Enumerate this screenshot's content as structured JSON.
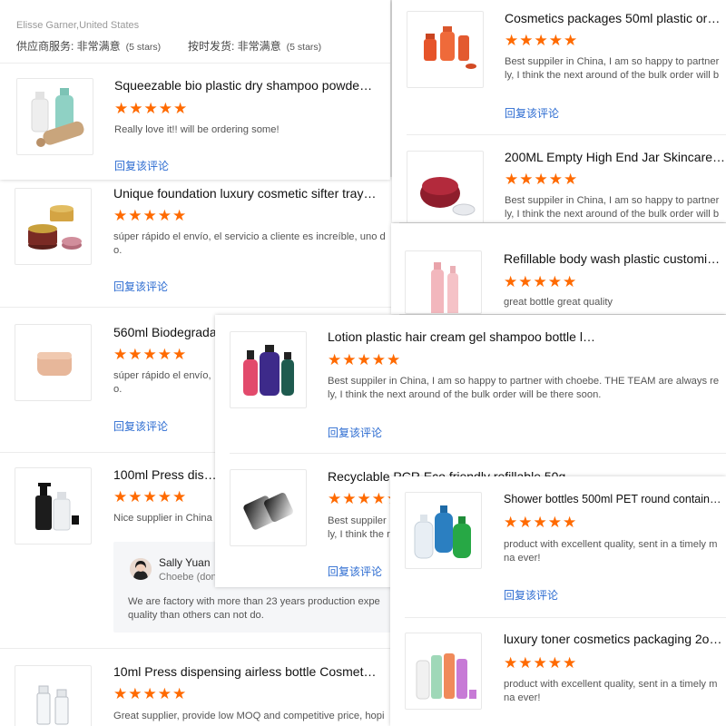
{
  "colors": {
    "star": "#ff6a00",
    "link": "#2b6bd1",
    "text": "#222222",
    "muted": "#555555"
  },
  "star_count": 5,
  "top_panel": {
    "reviewer": "Elisse Garner,United States",
    "supplier_service_label": "供应商服务: 非常满意",
    "supplier_service_stars": "(5 stars)",
    "shipping_label": "按时发货: 非常满意",
    "shipping_stars": "(5 stars)",
    "item": {
      "title": "Squeezable bio plastic dry shampoo powder b...",
      "review": "Really love it!! will be ordering some!",
      "reply": "回复该评论",
      "image_icon": "bottles-image"
    }
  },
  "left_items": [
    {
      "title": "Unique foundation luxury cosmetic sifter tray p...",
      "review_line1": "súper rápido el envío, el servicio a cliente es increíble, uno d",
      "review_line2": "o.",
      "reply": "回复该评论",
      "image_icon": "jar-image"
    },
    {
      "title": "560ml Biodegradal",
      "review_line1": "súper rápido el envío,",
      "review_line2": "o.",
      "reply": "回复该评论",
      "image_icon": "cream-jar-image"
    },
    {
      "title": "100ml Press dispe",
      "review_line1": "Nice supplier in China",
      "review_line2": "",
      "reply": "",
      "image_icon": "pump-bottle-image"
    },
    {
      "title": "10ml Press dispensing airless bottle Cosmetic...",
      "review_line1": "Great supplier, provide low MOQ and competitive price, hopi",
      "review_line2": "",
      "reply": "",
      "image_icon": "airless-bottle-image"
    }
  ],
  "seller_reply": {
    "name": "Sally Yuan",
    "company": "Choebe (dong",
    "text_line1": "We are factory with more than 23 years production expe",
    "text_line2": "quality than others can not do."
  },
  "middle_items": [
    {
      "title": "Lotion plastic hair cream gel shampoo bottle lo...",
      "review_line1": "Best suppiler in China, I am so happy to partner with choebe. THE TEAM are always re",
      "review_line2": "ly, I think the next around of the bulk order will be there soon.",
      "reply": "回复该评论",
      "image_icon": "shampoo-bottles-image"
    },
    {
      "title": "Recyclable PCR Eco friendly refillable 50g whol",
      "review_line1": "Best suppiler",
      "review_line2": "ly, I think the r",
      "reply": "回复该评论",
      "image_icon": "gradient-jar-image"
    }
  ],
  "right_items": [
    {
      "title": "Cosmetics packages 50ml plastic orange",
      "review_line1": "Best suppiler in China, I am so happy to partner",
      "review_line2": "ly, I think the next around of the bulk order will b",
      "reply": "回复该评论",
      "image_icon": "orange-bottles-image"
    },
    {
      "title": "200ML Empty High End Jar Skincare Pack",
      "review_line1": "Best suppiler in China, I am so happy to partner",
      "review_line2": "ly, I think the next around of the bulk order will b",
      "reply": "",
      "image_icon": "red-jar-image"
    },
    {
      "title": "Refillable body wash plastic customised e",
      "review_line1": "great bottle great quality",
      "review_line2": "",
      "reply": "",
      "image_icon": "pink-bottles-image"
    },
    {
      "title": "Shower bottles 500ml PET round container blue",
      "review_line1": "product with excellent quality, sent in a timely m",
      "review_line2": "na ever!",
      "reply": "回复该评论",
      "image_icon": "shower-bottles-image"
    },
    {
      "title": "luxury toner cosmetics packaging 2oz gre",
      "review_line1": "product with excellent quality, sent in a timely m",
      "review_line2": "na ever!",
      "reply": "",
      "image_icon": "toner-bottles-image"
    }
  ]
}
